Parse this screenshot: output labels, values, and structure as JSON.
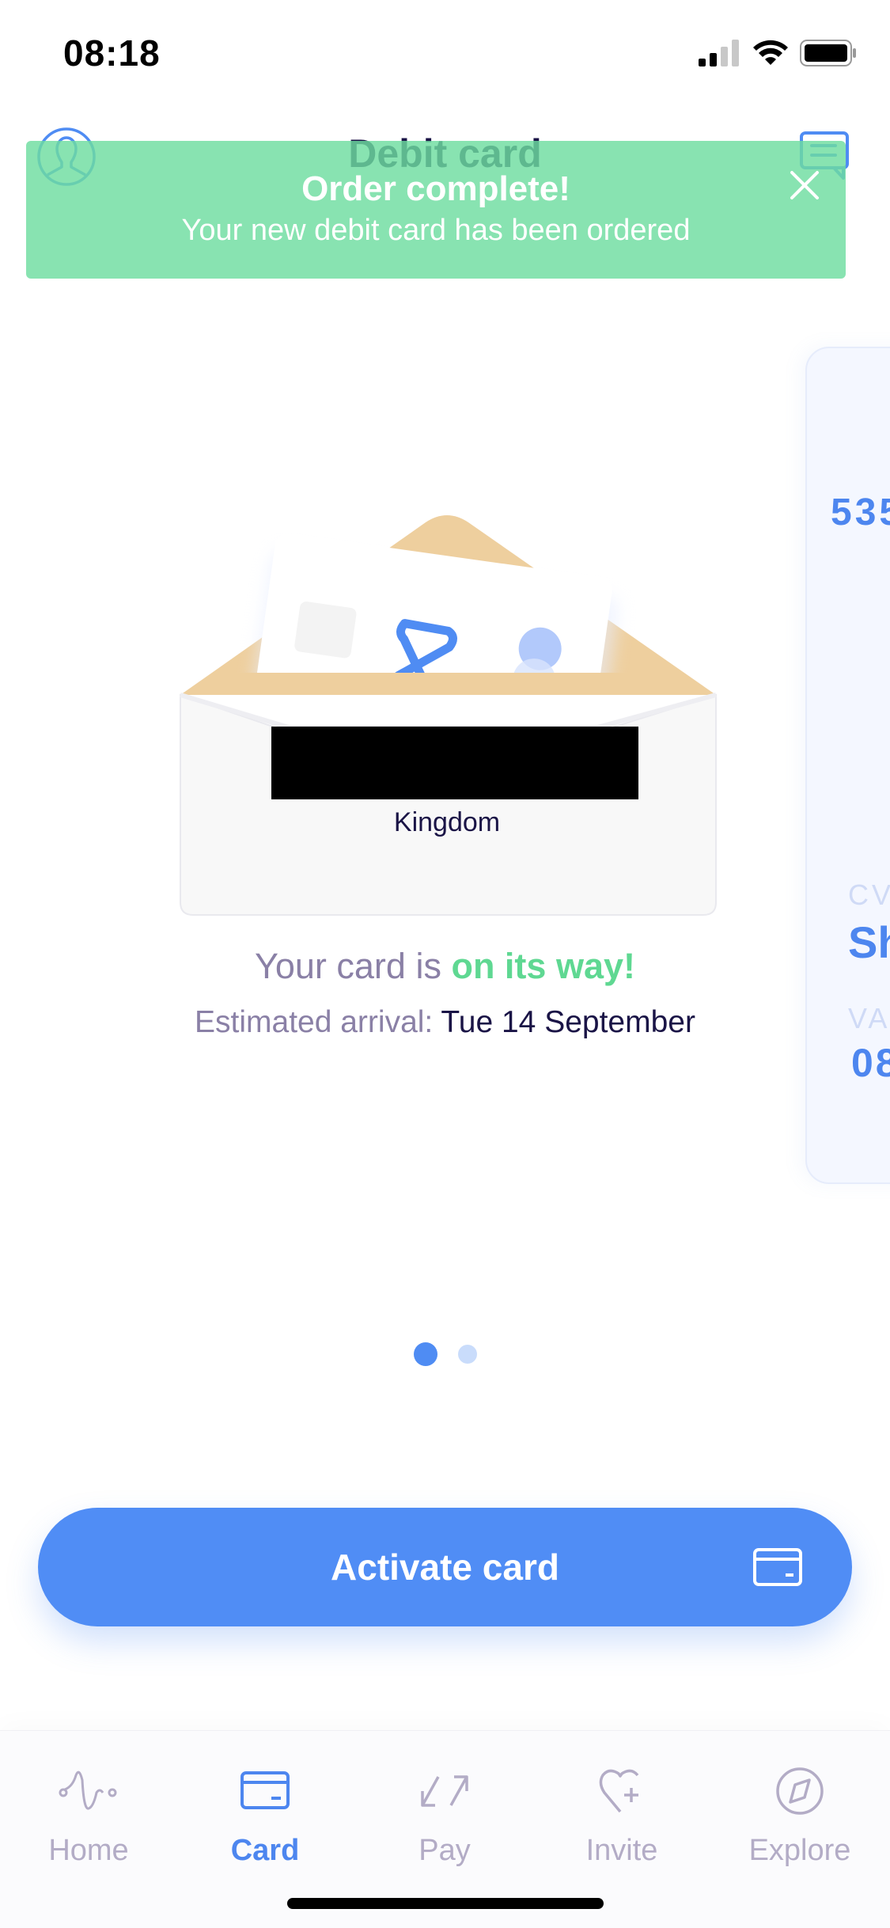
{
  "status_bar": {
    "time": "08:18",
    "icons": [
      "cellular-signal-icon",
      "wifi-icon",
      "battery-icon"
    ]
  },
  "header": {
    "title": "Debit card",
    "left_icon": "profile-icon",
    "right_icon": "chat-icon"
  },
  "toast": {
    "title": "Order complete!",
    "message": "Your new debit card has been ordered",
    "close_icon": "close-icon"
  },
  "envelope": {
    "address_line": "Kingdom",
    "address_redacted": true
  },
  "delivery": {
    "prefix": "Your card is ",
    "highlight": "on its way!",
    "arrival_label": "Estimated arrival: ",
    "arrival_date": "Tue 14 September"
  },
  "side_card": {
    "number_partial": "535",
    "cvv_label_partial": "CV",
    "cvv_value_partial": "Sh",
    "valid_label_partial": "VA",
    "valid_value_partial": "08"
  },
  "pager": {
    "total": 2,
    "current": 1
  },
  "activate_button": {
    "label": "Activate card",
    "icon": "card-icon"
  },
  "tabbar": {
    "items": [
      {
        "label": "Home",
        "icon": "home-wave-icon",
        "active": false
      },
      {
        "label": "Card",
        "icon": "card-icon",
        "active": true
      },
      {
        "label": "Pay",
        "icon": "transfer-arrows-icon",
        "active": false
      },
      {
        "label": "Invite",
        "icon": "heart-plus-icon",
        "active": false
      },
      {
        "label": "Explore",
        "icon": "compass-icon",
        "active": false
      }
    ]
  },
  "colors": {
    "accent_blue": "#508df5",
    "success_green": "#6edda0",
    "text_dark": "#1a1446",
    "text_muted": "#8a80a6",
    "tab_inactive": "#b3acc6"
  }
}
